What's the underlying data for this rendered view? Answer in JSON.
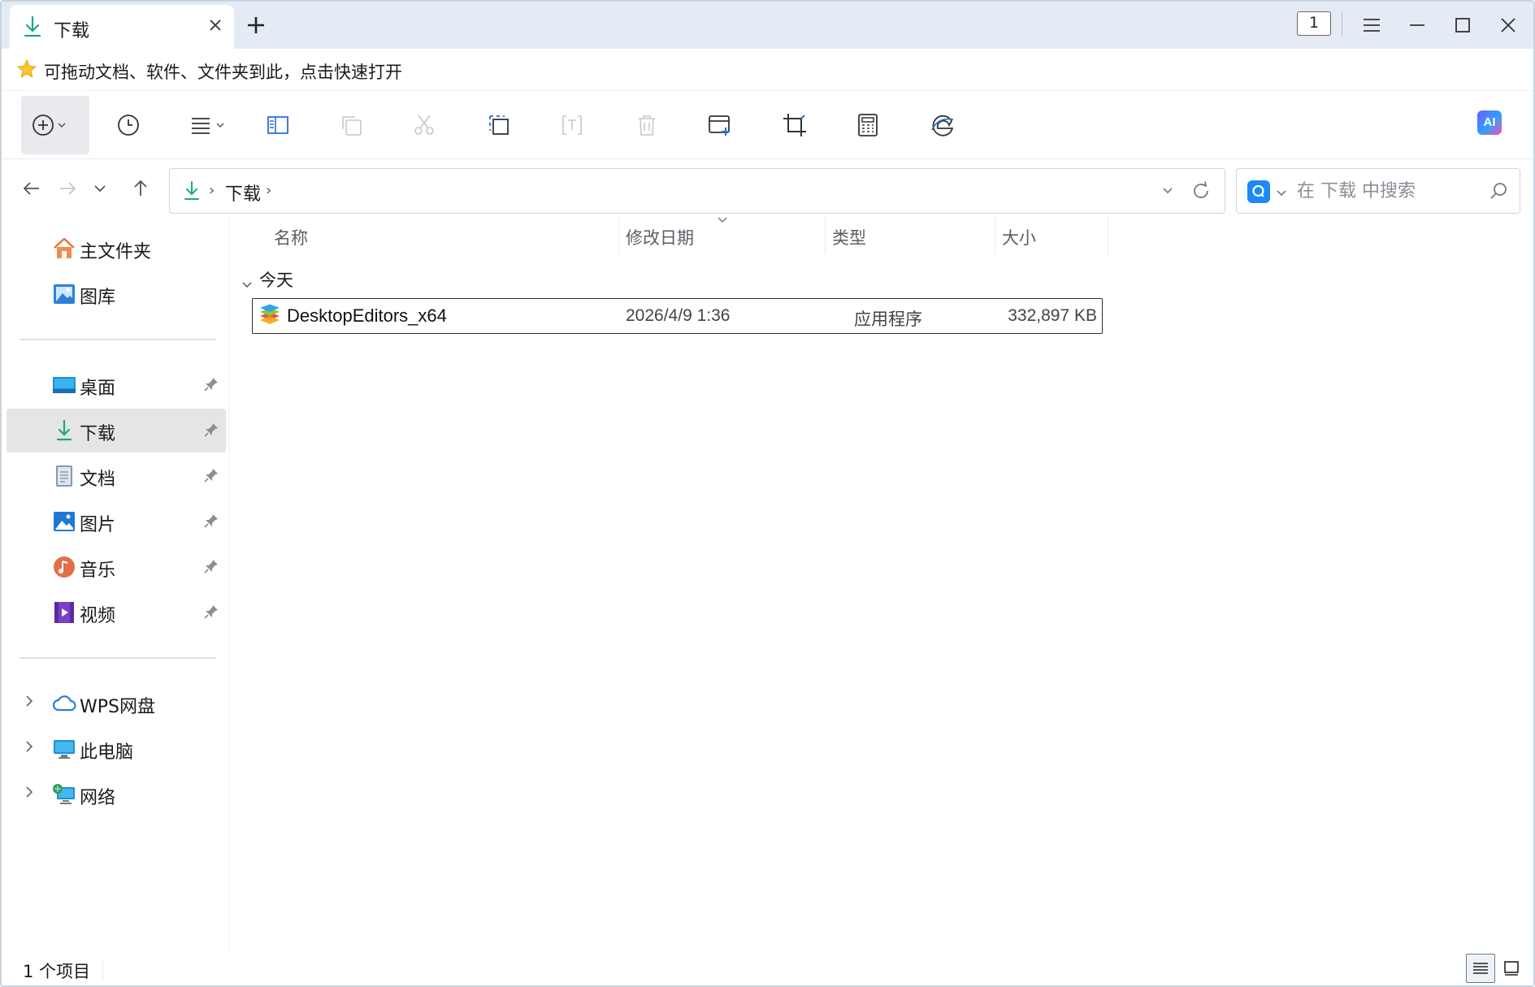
{
  "window": {
    "tab_title": "下载",
    "tab_count": "1"
  },
  "favorites_bar": {
    "hint": "可拖动文档、软件、文件夹到此，点击快速打开"
  },
  "toolbar": {
    "ai_label": "AI"
  },
  "address": {
    "path": [
      "下载"
    ],
    "search_placeholder": "在 下载 中搜索"
  },
  "sidebar": {
    "top": [
      {
        "label": "主文件夹",
        "icon": "home-icon"
      },
      {
        "label": "图库",
        "icon": "gallery-icon"
      }
    ],
    "pinned": [
      {
        "label": "桌面",
        "icon": "desktop-icon"
      },
      {
        "label": "下载",
        "icon": "download-icon"
      },
      {
        "label": "文档",
        "icon": "documents-icon"
      },
      {
        "label": "图片",
        "icon": "pictures-icon"
      },
      {
        "label": "音乐",
        "icon": "music-icon"
      },
      {
        "label": "视频",
        "icon": "video-icon"
      }
    ],
    "locations": [
      {
        "label": "WPS网盘",
        "icon": "cloud-icon"
      },
      {
        "label": "此电脑",
        "icon": "computer-icon"
      },
      {
        "label": "网络",
        "icon": "network-icon"
      }
    ],
    "selected": "下载"
  },
  "columns": {
    "name": "名称",
    "modified": "修改日期",
    "type": "类型",
    "size": "大小"
  },
  "groups": [
    {
      "label": "今天",
      "files": [
        {
          "name": "DesktopEditors_x64",
          "modified": "2026/4/9 1:36",
          "type": "应用程序",
          "size": "332,897 KB"
        }
      ]
    }
  ],
  "status": {
    "item_count": "1 个项目"
  },
  "colors": {
    "accent_download": "#1aa58c",
    "titlebar_bg": "#e4ebf4",
    "selection_bg": "#e5e5e5",
    "search_engine": "#1e88f5"
  }
}
